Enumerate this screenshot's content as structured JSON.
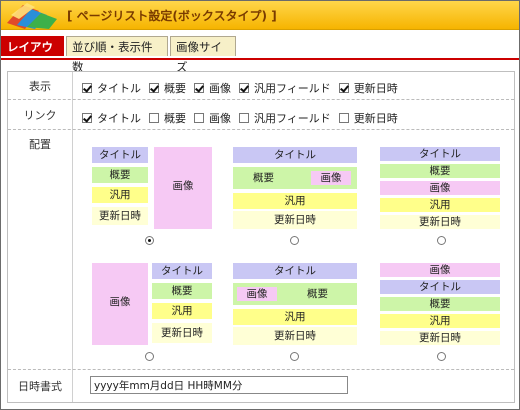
{
  "window": {
    "title": "[ ページリスト設定(ボックスタイプ) ]",
    "colors": {
      "accent": "#cc0000",
      "title_bar": "#f6b400"
    }
  },
  "tabs": [
    {
      "label": "レイアウト",
      "active": true
    },
    {
      "label": "並び順・表示件数",
      "active": false
    },
    {
      "label": "画像サイズ",
      "active": false
    }
  ],
  "rows": {
    "display": {
      "label": "表示",
      "options": [
        {
          "label": "タイトル",
          "checked": true
        },
        {
          "label": "概要",
          "checked": true
        },
        {
          "label": "画像",
          "checked": true
        },
        {
          "label": "汎用フィールド",
          "checked": true
        },
        {
          "label": "更新日時",
          "checked": true
        }
      ]
    },
    "link": {
      "label": "リンク",
      "options": [
        {
          "label": "タイトル",
          "checked": true
        },
        {
          "label": "概要",
          "checked": false
        },
        {
          "label": "画像",
          "checked": false
        },
        {
          "label": "汎用フィールド",
          "checked": false
        },
        {
          "label": "更新日時",
          "checked": false
        }
      ]
    },
    "placement": {
      "label": "配置",
      "selected_index": 0,
      "blocks": {
        "title": "タイトル",
        "summary": "概要",
        "image": "画像",
        "general": "汎用",
        "date": "更新日時"
      },
      "colors": {
        "title": "#c9c7f4",
        "summary": "#cdf5a8",
        "image": "#f6c9f4",
        "general": "#ffff8a",
        "date": "#ffffd6"
      }
    },
    "date_format": {
      "label": "日時書式",
      "value": "yyyy年mm月dd日 HH時MM分"
    }
  }
}
